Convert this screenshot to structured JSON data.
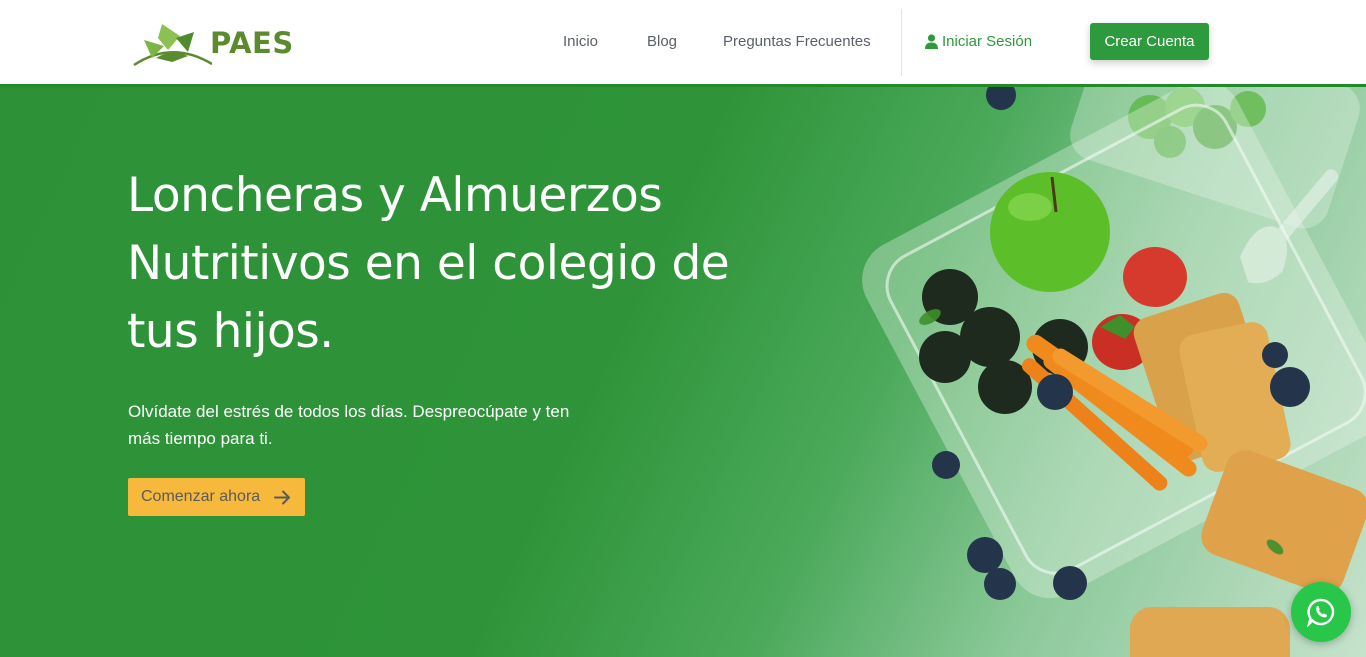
{
  "brand": {
    "name": "PAES",
    "logo_icon": "leaf-logo-icon"
  },
  "nav": {
    "items": [
      {
        "label": "Inicio"
      },
      {
        "label": "Blog"
      },
      {
        "label": "Preguntas Frecuentes"
      }
    ],
    "login_label": "Iniciar Sesión",
    "login_icon": "user-icon",
    "signup_label": "Crear Cuenta"
  },
  "hero": {
    "title": "Loncheras y Almuerzos Nutritivos en el colegio de tus hijos.",
    "subtitle": "Olvídate del estrés de todos los días. Despreocúpate y ten más tiempo para ti.",
    "cta_label": "Comenzar ahora",
    "cta_icon": "arrow-right-icon",
    "image": "lunchbox-food-photo"
  },
  "floating": {
    "whatsapp_icon": "whatsapp-icon"
  },
  "colors": {
    "primary": "#2c9a3d",
    "header_border": "#218a2a",
    "cta": "#f6b93b",
    "logo": "#5c8a2e",
    "whatsapp": "#28c74a"
  }
}
